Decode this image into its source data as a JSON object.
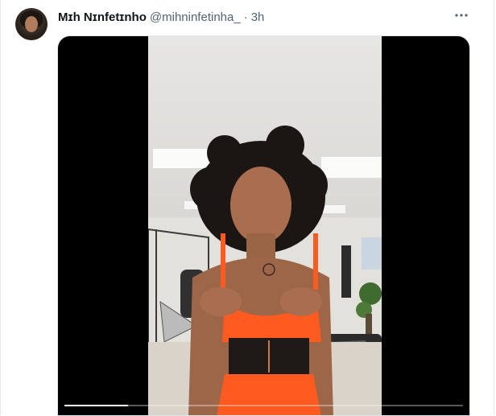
{
  "post": {
    "display_name": "Mɪh Nɪnfetɪnho",
    "handle": "@mihninfetinha_",
    "separator": "·",
    "time": "3h"
  },
  "icons": {
    "avatar": "avatar-image",
    "more": "more-horizontal-icon"
  },
  "media": {
    "type": "video",
    "progress": 0.16
  },
  "colors": {
    "text_primary": "#0f1419",
    "text_secondary": "#536471",
    "media_background": "#000000",
    "outfit": "#ff5a1f"
  }
}
